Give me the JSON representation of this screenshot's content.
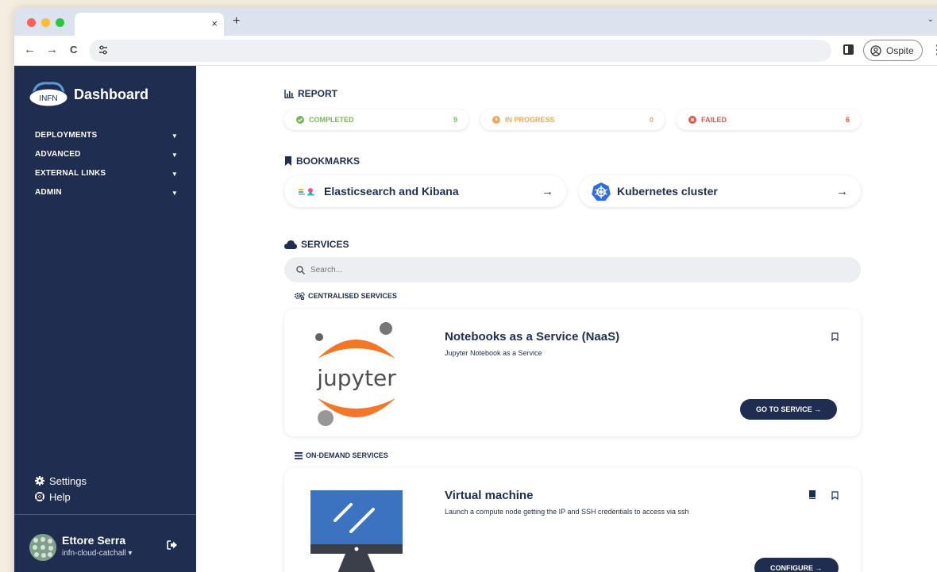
{
  "browser": {
    "tab_close": "×",
    "new_tab": "+",
    "tab_chevron": "⌄",
    "back": "←",
    "forward": "→",
    "reload": "C",
    "profile_label": "Ospite",
    "menu": "⋮",
    "dot_colors": [
      "#ff5f57",
      "#febc2e",
      "#28c840"
    ]
  },
  "sidebar": {
    "brand": "Dashboard",
    "logo_text": "INFN",
    "menu": [
      {
        "label": "DEPLOYMENTS"
      },
      {
        "label": "ADVANCED"
      },
      {
        "label": "EXTERNAL LINKS"
      },
      {
        "label": "ADMIN"
      }
    ],
    "settings_label": "Settings",
    "help_label": "Help",
    "user_name": "Ettore Serra",
    "user_group": "infn-cloud-catchall ▾"
  },
  "report": {
    "title": "REPORT",
    "items": [
      {
        "label": "COMPLETED",
        "count": "9",
        "color": "#7ab55c"
      },
      {
        "label": "IN PROGRESS",
        "count": "0",
        "color": "#f0a85a"
      },
      {
        "label": "FAILED",
        "count": "6",
        "color": "#e2574c"
      }
    ]
  },
  "bookmarks": {
    "title": "BOOKMARKS",
    "items": [
      {
        "label": "Elasticsearch and Kibana",
        "arrow": "→"
      },
      {
        "label": "Kubernetes cluster",
        "arrow": "→"
      }
    ]
  },
  "services": {
    "title": "SERVICES",
    "search_placeholder": "Search...",
    "centralised_title": "CENTRALISED SERVICES",
    "ondemand_title": "ON-DEMAND SERVICES",
    "naas": {
      "title": "Notebooks as a Service (NaaS)",
      "description": "Jupyter Notebook as a Service",
      "logo_text": "jupyter",
      "button": "GO TO SERVICE →"
    },
    "vm": {
      "title": "Virtual machine",
      "description": "Launch a compute node getting the IP and SSH credentials to access via ssh",
      "button": "CONFIGURE →"
    }
  },
  "colors": {
    "navy": "#1f2d50",
    "jupyter_orange": "#f37726",
    "vm_blue": "#3b73c1"
  }
}
